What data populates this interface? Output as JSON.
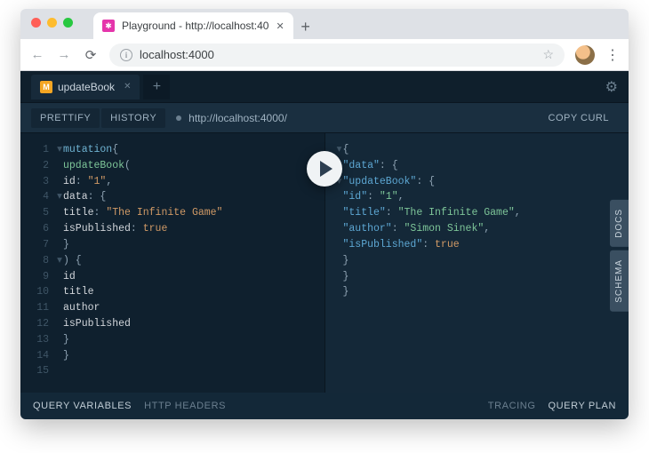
{
  "browser": {
    "tab_title": "Playground - http://localhost:40",
    "new_tab_icon": "+",
    "url": "localhost:4000",
    "nav": {
      "back": "←",
      "forward": "→",
      "reload": "⟳"
    },
    "menu_icon": "⋮",
    "star_icon": "☆"
  },
  "playground": {
    "tab_name": "updateBook",
    "tab_badge": "M",
    "new_tab": "+",
    "settings_icon": "⚙",
    "toolbar": {
      "prettify": "PRETTIFY",
      "history": "HISTORY",
      "endpoint": "http://localhost:4000/",
      "copy_curl": "COPY CURL"
    },
    "side": {
      "docs": "DOCS",
      "schema": "SCHEMA"
    },
    "footer": {
      "query_variables": "QUERY VARIABLES",
      "http_headers": "HTTP HEADERS",
      "tracing": "TRACING",
      "query_plan": "QUERY PLAN"
    },
    "query": {
      "lines": [
        "mutation {",
        "  updateBook(",
        "    id: \"1\",",
        "    data: {",
        "      title: \"The Infinite Game\"",
        "      isPublished: true",
        "    }",
        "  ) {",
        "    id",
        "    title",
        "    author",
        "    isPublished",
        "  }",
        "}",
        ""
      ]
    },
    "response": {
      "data": {
        "updateBook": {
          "id": "1",
          "title": "The Infinite Game",
          "author": "Simon Sinek",
          "isPublished": true
        }
      }
    }
  }
}
